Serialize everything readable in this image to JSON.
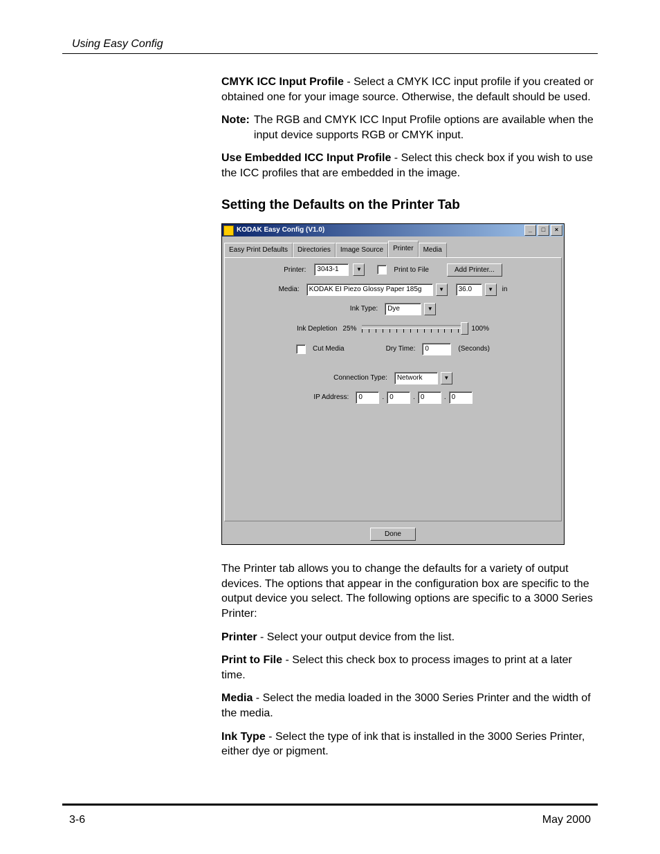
{
  "header": {
    "left": "Using Easy Config"
  },
  "para_cmyk_bold": "CMYK ICC Input Profile",
  "para_cmyk_rest": " - Select a CMYK ICC input profile if you created or obtained one for your image source. Otherwise, the default should be used.",
  "note_label": "Note:",
  "note_text": "The RGB and CMYK ICC Input Profile options are available when the input device supports RGB or CMYK input.",
  "para_embed_bold": "Use Embedded ICC Input Profile",
  "para_embed_rest": " - Select this check box if you wish to use the ICC profiles that are embedded in the image.",
  "section_heading": "Setting the Defaults on the Printer Tab",
  "window": {
    "title": "KODAK Easy Config (V1.0)",
    "tabs": [
      "Easy Print Defaults",
      "Directories",
      "Image Source",
      "Printer",
      "Media"
    ],
    "active_tab_index": 3,
    "labels": {
      "printer": "Printer:",
      "print_to_file": "Print to File",
      "add_printer": "Add Printer...",
      "media": "Media:",
      "media_unit": "in",
      "ink_type": "Ink Type:",
      "ink_depletion": "Ink Depletion",
      "ink_low": "25%",
      "ink_high": "100%",
      "cut_media": "Cut Media",
      "dry_time": "Dry Time:",
      "seconds": "(Seconds)",
      "conn_type": "Connection Type:",
      "ip_address": "IP Address:"
    },
    "values": {
      "printer": "3043-1",
      "media": "KODAK EI Piezo Glossy Paper 185g",
      "media_width": "36.0",
      "ink_type": "Dye",
      "dry_time": "0",
      "conn_type": "Network",
      "ip": [
        "0",
        "0",
        "0",
        "0"
      ]
    },
    "done_label": "Done"
  },
  "para_after_img": "The Printer tab allows you to change the defaults for a variety of output devices. The options that appear in the configuration box are specific to the output device you select. The following options are specific to a 3000 Series Printer:",
  "opt_printer_bold": "Printer",
  "opt_printer_rest": " - Select your output device from the list.",
  "opt_ptf_bold": "Print to File",
  "opt_ptf_rest": " - Select this check box to process images to print at a later time.",
  "opt_media_bold": "Media",
  "opt_media_rest": " - Select the media loaded in the 3000 Series Printer and the width of the media.",
  "opt_ink_bold": "Ink Type",
  "opt_ink_rest": " - Select the type of ink that is installed in the 3000 Series Printer, either dye or pigment.",
  "footer": {
    "left": "3-6",
    "right": "May 2000"
  }
}
